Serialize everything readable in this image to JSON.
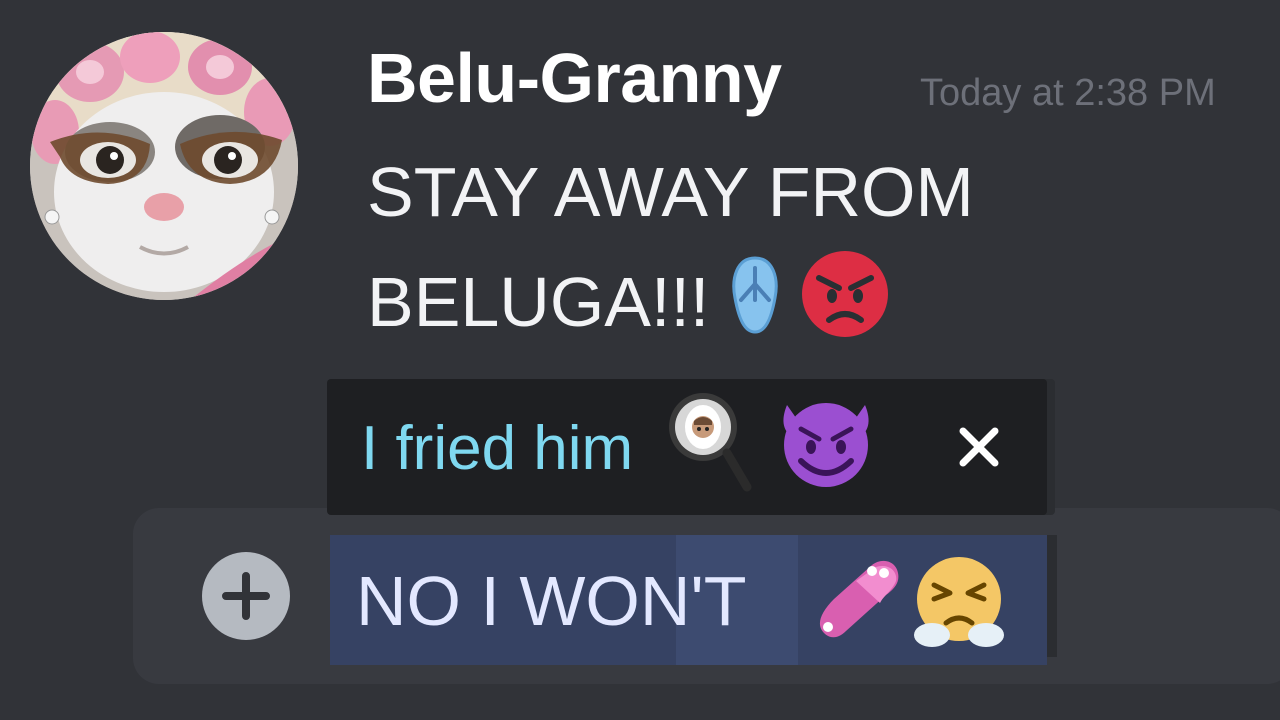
{
  "message": {
    "author": "Belu-Granny",
    "timestamp": "Today at 2:38 PM",
    "line1": "STAY AWAY FROM",
    "line2": "BELUGA!!!",
    "emojis": [
      "flip-flop",
      "angry-face"
    ]
  },
  "reply": {
    "text": "I fried him",
    "emojis": [
      "frying-pan-face",
      "smiling-face-with-horns"
    ],
    "close_label": "close"
  },
  "composer": {
    "text": "NO I WON'T",
    "emojis": [
      "pink-slipper",
      "face-with-steam-from-nose"
    ]
  },
  "colors": {
    "background": "#313338",
    "username": "#ffffff",
    "timestamp": "#6d7079",
    "reply_text": "#7fd8f0",
    "reply_background": "#1e1f22",
    "selection": "#3d4b70",
    "composer": "#383a40"
  }
}
